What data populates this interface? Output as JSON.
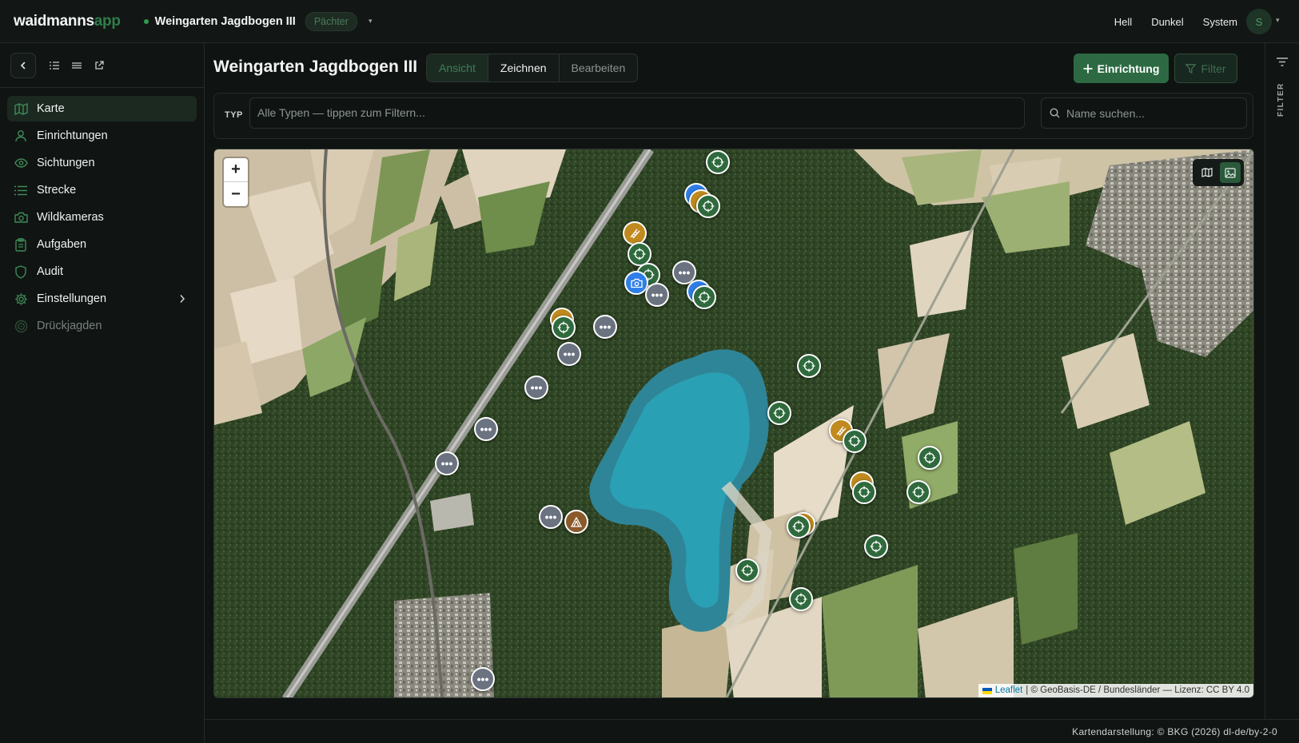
{
  "app": {
    "brand_a": "waidmanns",
    "brand_b": "app"
  },
  "header": {
    "revier_name": "Weingarten Jagdbogen III",
    "role_badge": "Pächter",
    "theme_options": [
      "Hell",
      "Dunkel",
      "System"
    ],
    "avatar_initial": "S"
  },
  "sidebar": {
    "items": [
      {
        "label": "Karte",
        "icon": "map-icon",
        "active": true
      },
      {
        "label": "Einrichtungen",
        "icon": "user-pin-icon"
      },
      {
        "label": "Sichtungen",
        "icon": "eye-icon"
      },
      {
        "label": "Strecke",
        "icon": "list-icon"
      },
      {
        "label": "Wildkameras",
        "icon": "camera-icon"
      },
      {
        "label": "Aufgaben",
        "icon": "clipboard-icon"
      },
      {
        "label": "Audit",
        "icon": "shield-icon"
      },
      {
        "label": "Einstellungen",
        "icon": "gear-icon",
        "has_submenu": true
      },
      {
        "label": "Drückjagden",
        "icon": "target-icon",
        "disabled": true
      }
    ]
  },
  "page": {
    "title": "Weingarten Jagdbogen III",
    "modes": [
      "Ansicht",
      "Zeichnen",
      "Bearbeiten"
    ],
    "active_mode": "Ansicht",
    "add_button": "Einrichtung",
    "filter_button": "Filter"
  },
  "filters": {
    "type_label": "TYP",
    "type_placeholder": "Alle Typen — tippen zum Filtern...",
    "name_placeholder": "Name suchen..."
  },
  "map": {
    "attribution_link": "Leaflet",
    "attribution_text": "| © GeoBasis-DE / Bundesländer — Lizenz: CC BY 4.0",
    "base_layer": "satellite"
  },
  "right_rail": {
    "title": "FILTER"
  },
  "footer": {
    "credit": "Kartendarstellung: © BKG (2026) dl-de/by-2-0"
  },
  "colors": {
    "accent": "#2d6a43",
    "hochsitz_marker": "#2f6a3d",
    "other_marker": "#6b7280",
    "camera_marker": "#2f7ee8",
    "leiter_marker": "#c08a1e",
    "zelt_marker": "#8a5a2b"
  }
}
